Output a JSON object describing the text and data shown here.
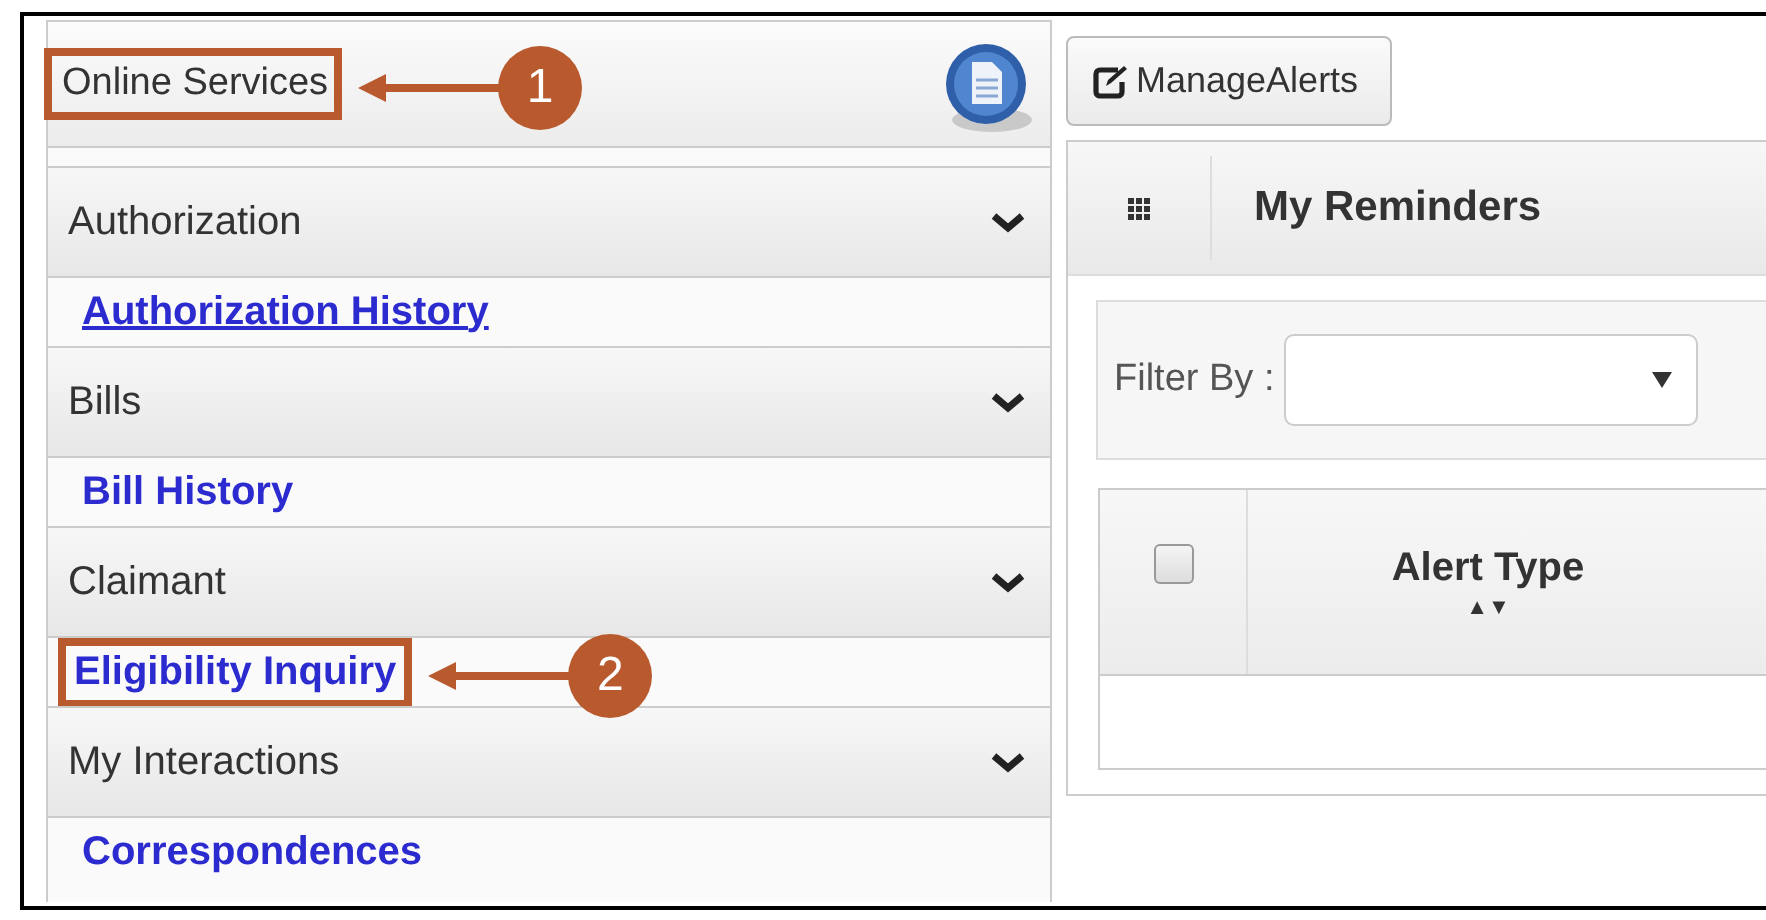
{
  "sidebar": {
    "title": "Online Services",
    "callout": "1",
    "sections": [
      {
        "title": "Authorization",
        "expanded": true,
        "items": [
          {
            "label": "Authorization History",
            "underlined": true
          }
        ]
      },
      {
        "title": "Bills",
        "expanded": true,
        "items": [
          {
            "label": "Bill History",
            "underlined": false
          }
        ]
      },
      {
        "title": "Claimant",
        "expanded": true,
        "items": [
          {
            "label": "Eligibility Inquiry",
            "underlined": false,
            "callout": "2"
          }
        ]
      },
      {
        "title": "My Interactions",
        "expanded": true,
        "items": [
          {
            "label": "Correspondences",
            "underlined": false
          }
        ]
      }
    ]
  },
  "toolbar": {
    "button": "ManageAlerts"
  },
  "reminders": {
    "title": "My Reminders",
    "filter_label": "Filter By :",
    "table": {
      "columns": [
        {
          "kind": "checkbox",
          "checked": false
        },
        {
          "kind": "text",
          "label": "Alert Type",
          "sort": "▲▼"
        }
      ]
    }
  }
}
